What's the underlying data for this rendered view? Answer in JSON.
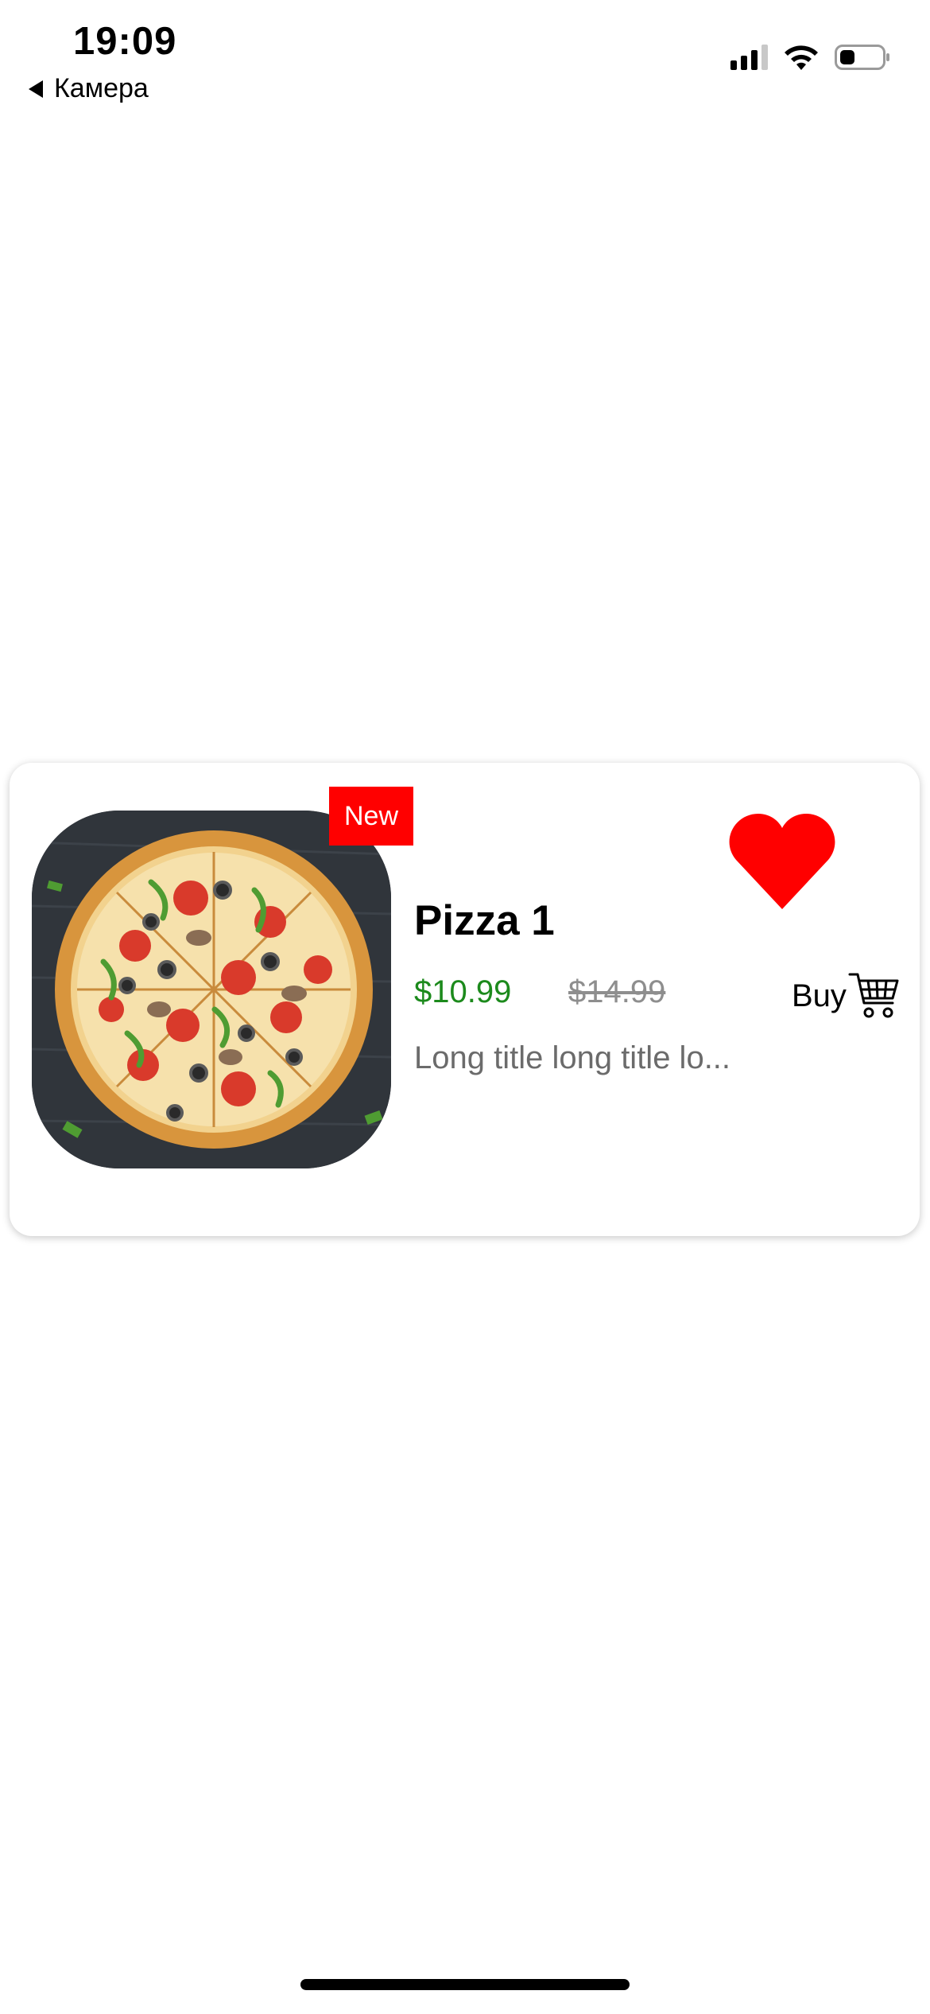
{
  "status_bar": {
    "time": "19:09",
    "back_label": "Камера",
    "signal_icon": "cellular-signal-icon",
    "wifi_icon": "wifi-icon",
    "battery_icon": "battery-icon",
    "battery_level": 0.35
  },
  "product_card": {
    "badge": "New",
    "title": "Pizza 1",
    "price": "$10.99",
    "old_price": "$14.99",
    "description": "Long title long title lo...",
    "buy_label": "Buy",
    "favorite_icon": "heart-icon",
    "cart_icon": "shopping-cart-icon",
    "image_icon": "pizza-image",
    "colors": {
      "badge_bg": "#ff0000",
      "heart": "#ff0000",
      "price": "#1c8a1c",
      "old_price": "#8e8e8e",
      "description": "#6b6b6b"
    }
  }
}
